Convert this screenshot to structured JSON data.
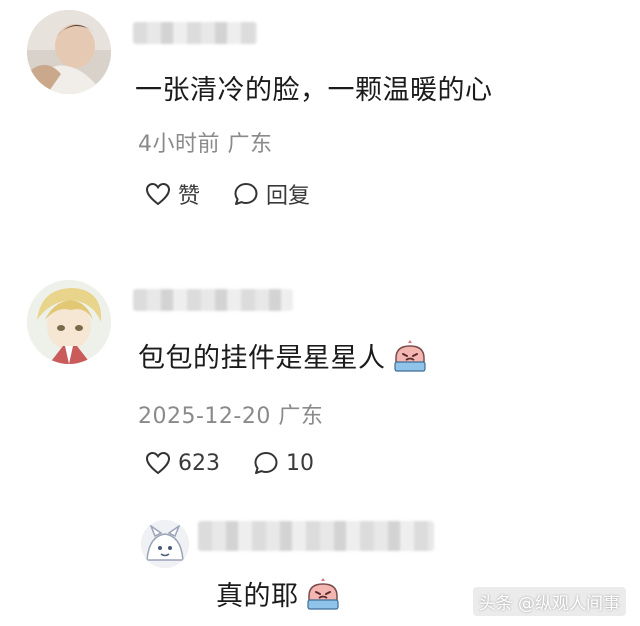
{
  "comments": [
    {
      "text": "一张清冷的脸，一颗温暖的心",
      "meta": "4小时前 广东",
      "like_label": "赞",
      "reply_label": "回复",
      "avatar_icon": "baby-photo-avatar"
    },
    {
      "text": "包包的挂件是星星人",
      "meta": "2025-12-20 广东",
      "like_label": "623",
      "reply_label": "10",
      "avatar_icon": "anime-character-avatar",
      "emoji": "crying-face-emoji"
    },
    {
      "text": "真的耶",
      "avatar_icon": "cartoon-avatar",
      "emoji": "crying-face-emoji"
    }
  ],
  "watermark": "头条 @纵观人间事",
  "colors": {
    "text": "#1b1b1b",
    "meta": "#8a8a8a",
    "background": "#ffffff"
  }
}
